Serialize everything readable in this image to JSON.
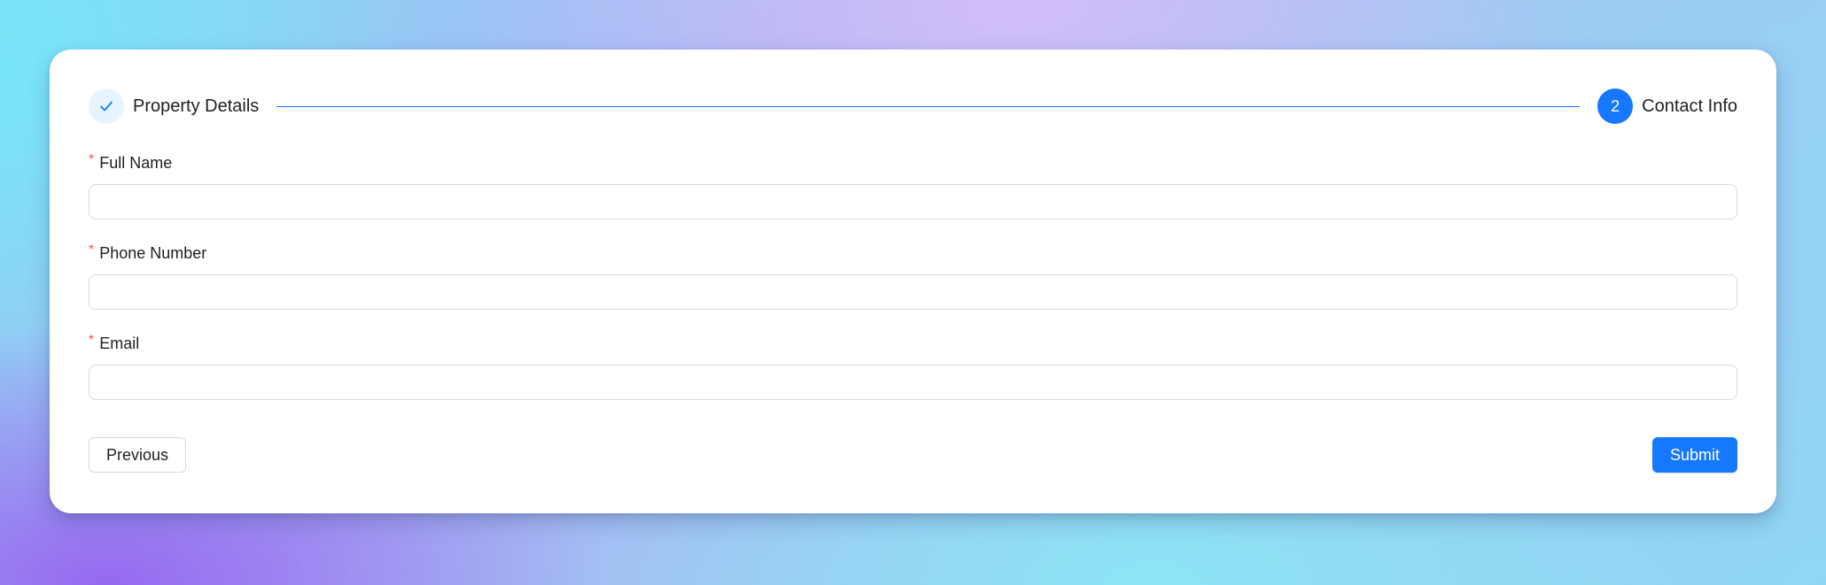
{
  "steps": [
    {
      "title": "Property Details",
      "status": "finished",
      "icon": "check-icon"
    },
    {
      "title": "Contact Info",
      "status": "active",
      "number": "2"
    }
  ],
  "form": {
    "fields": [
      {
        "label": "Full Name",
        "required_mark": "*",
        "value": "",
        "placeholder": ""
      },
      {
        "label": "Phone Number",
        "required_mark": "*",
        "value": "",
        "placeholder": ""
      },
      {
        "label": "Email",
        "required_mark": "*",
        "value": "",
        "placeholder": ""
      }
    ]
  },
  "actions": {
    "previous_label": "Previous",
    "submit_label": "Submit"
  },
  "colors": {
    "primary": "#1677ff",
    "finished_step_bg": "#e6f4ff",
    "required": "#ff4d4f",
    "border": "#d9d9d9"
  }
}
